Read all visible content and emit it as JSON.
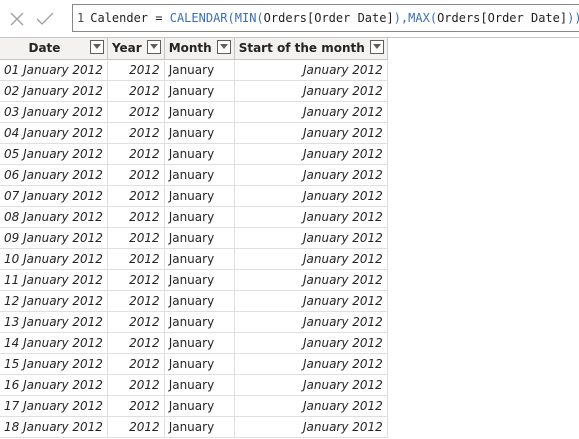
{
  "formula_bar": {
    "line_number": "1",
    "text_prefix": "Calender = ",
    "func_calendar": "CALENDAR(",
    "func_min": "MIN(",
    "arg_min": "Orders[Order Date]",
    "sep": "),",
    "func_max": "MAX(",
    "arg_max": "Orders[Order Date]",
    "text_suffix": "))"
  },
  "icons": {
    "cancel": "close-icon",
    "commit": "checkmark-icon",
    "filter": "chevron-down-icon"
  },
  "table": {
    "headers": [
      "Date",
      "Year",
      "Month",
      "Start of the month"
    ],
    "rows": [
      [
        "01 January 2012",
        "2012",
        "January",
        "January 2012"
      ],
      [
        "02 January 2012",
        "2012",
        "January",
        "January 2012"
      ],
      [
        "03 January 2012",
        "2012",
        "January",
        "January 2012"
      ],
      [
        "04 January 2012",
        "2012",
        "January",
        "January 2012"
      ],
      [
        "05 January 2012",
        "2012",
        "January",
        "January 2012"
      ],
      [
        "06 January 2012",
        "2012",
        "January",
        "January 2012"
      ],
      [
        "07 January 2012",
        "2012",
        "January",
        "January 2012"
      ],
      [
        "08 January 2012",
        "2012",
        "January",
        "January 2012"
      ],
      [
        "09 January 2012",
        "2012",
        "January",
        "January 2012"
      ],
      [
        "10 January 2012",
        "2012",
        "January",
        "January 2012"
      ],
      [
        "11 January 2012",
        "2012",
        "January",
        "January 2012"
      ],
      [
        "12 January 2012",
        "2012",
        "January",
        "January 2012"
      ],
      [
        "13 January 2012",
        "2012",
        "January",
        "January 2012"
      ],
      [
        "14 January 2012",
        "2012",
        "January",
        "January 2012"
      ],
      [
        "15 January 2012",
        "2012",
        "January",
        "January 2012"
      ],
      [
        "16 January 2012",
        "2012",
        "January",
        "January 2012"
      ],
      [
        "17 January 2012",
        "2012",
        "January",
        "January 2012"
      ],
      [
        "18 January 2012",
        "2012",
        "January",
        "January 2012"
      ]
    ]
  },
  "colors": {
    "function": "#3b6fb6",
    "header_bg": "#f3f2f1",
    "grid_line": "#e1dfdd"
  }
}
